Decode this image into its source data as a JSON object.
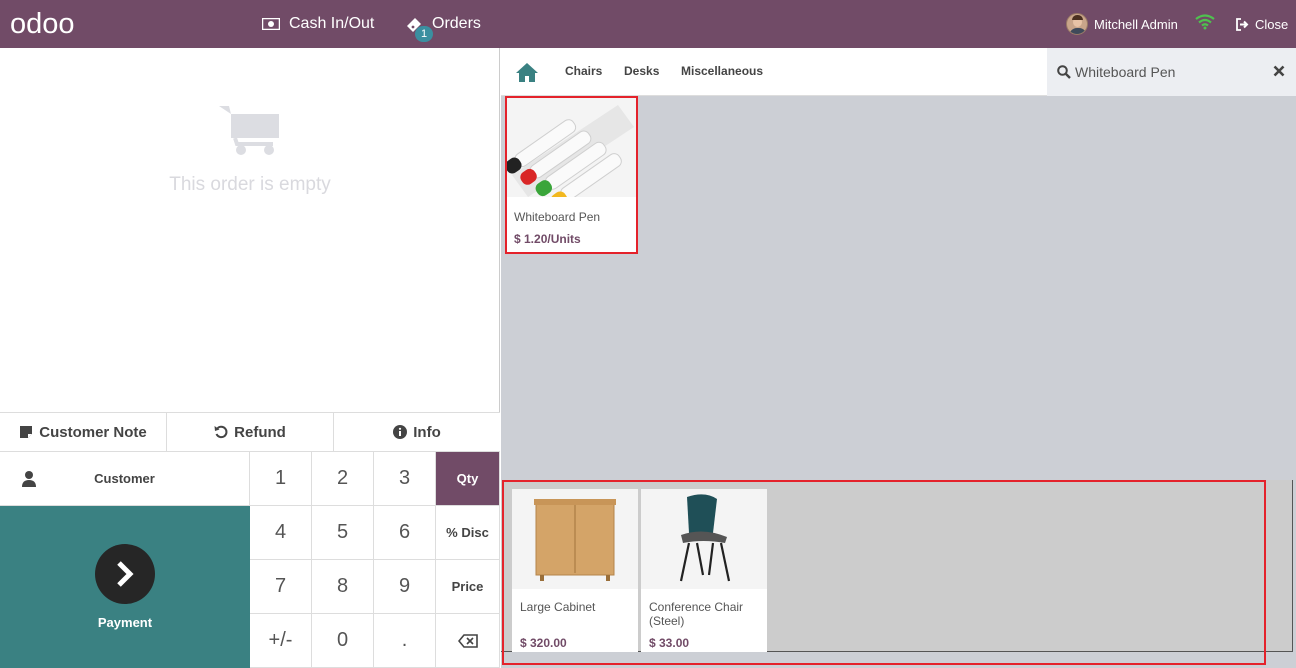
{
  "topbar": {
    "logo_text": "odoo",
    "cash_label": "Cash In/Out",
    "orders_label": "Orders",
    "orders_count": "1",
    "user_name": "Mitchell Admin",
    "close_label": "Close"
  },
  "order": {
    "empty_text": "This order is empty"
  },
  "controls": {
    "customer_note": "Customer Note",
    "refund": "Refund",
    "info": "Info",
    "customer": "Customer",
    "payment": "Payment"
  },
  "numpad": {
    "k1": "1",
    "k2": "2",
    "k3": "3",
    "qty": "Qty",
    "k4": "4",
    "k5": "5",
    "k6": "6",
    "disc": "% Disc",
    "k7": "7",
    "k8": "8",
    "k9": "9",
    "price": "Price",
    "plusminus": "+/-",
    "k0": "0",
    "dot": "."
  },
  "categories": [
    "Chairs",
    "Desks",
    "Miscellaneous"
  ],
  "search": {
    "value": "Whiteboard Pen"
  },
  "products": [
    {
      "name": "Whiteboard Pen",
      "price": "$ 1.20/Units"
    },
    {
      "name": "Large Cabinet",
      "price": "$ 320.00"
    },
    {
      "name": "Conference Chair (Steel)",
      "price": "$ 33.00"
    }
  ],
  "colors": {
    "brand": "#714B67",
    "payment": "#3a8182",
    "highlight": "#e4222b"
  }
}
